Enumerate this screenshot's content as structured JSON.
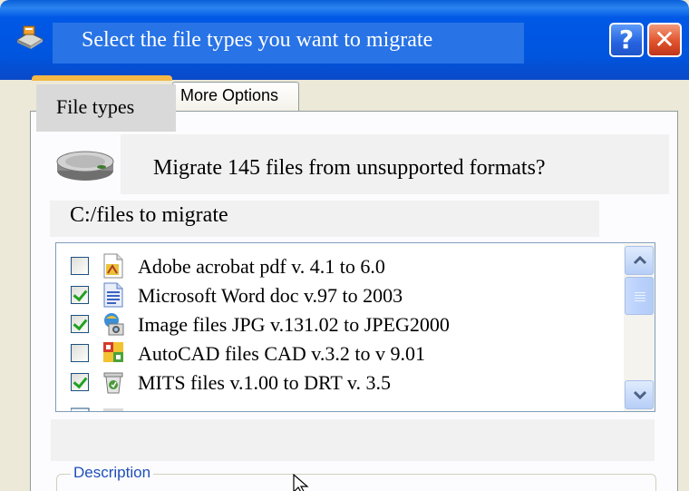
{
  "window": {
    "title": "Select the file types you want to migrate",
    "help_label": "?",
    "close_label": "✕"
  },
  "tabs": [
    {
      "label": "File types",
      "active": true
    },
    {
      "label": "More Options",
      "active": false
    }
  ],
  "prompt": {
    "question": "Migrate 145 files from unsupported formats?",
    "path": "C:/files to migrate"
  },
  "file_types": [
    {
      "label": "Adobe acrobat pdf v. 4.1 to 6.0",
      "checked": false,
      "icon": "pdf-file-icon"
    },
    {
      "label": "Microsoft Word doc v.97 to 2003",
      "checked": true,
      "icon": "word-doc-icon"
    },
    {
      "label": "Image files JPG v.131.02 to JPEG2000",
      "checked": true,
      "icon": "image-file-icon"
    },
    {
      "label": "AutoCAD files CAD v.3.2 to v 9.01",
      "checked": false,
      "icon": "autocad-file-icon"
    },
    {
      "label": "MITS files v.1.00 to DRT v. 3.5",
      "checked": true,
      "icon": "mits-file-icon"
    }
  ],
  "description": {
    "label": "Description"
  },
  "colors": {
    "titlebar": "#0055DE",
    "accent_tab": "#F6B846",
    "check_green": "#21A121",
    "group_label": "#1E4FB8"
  }
}
